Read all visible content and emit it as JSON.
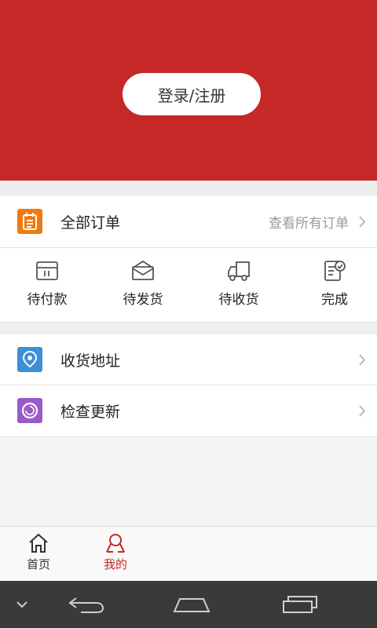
{
  "header": {
    "login_label": "登录/注册",
    "background": "#c62828"
  },
  "orders": {
    "title": "全部订单",
    "view_all": "查看所有订单",
    "icon": "order-list-icon",
    "icon_color": "#f07a12",
    "statuses": [
      {
        "label": "待付款",
        "icon": "wallet-icon"
      },
      {
        "label": "待发货",
        "icon": "package-icon"
      },
      {
        "label": "待收货",
        "icon": "truck-icon"
      },
      {
        "label": "完成",
        "icon": "checklist-icon"
      }
    ]
  },
  "menu": [
    {
      "label": "收货地址",
      "icon": "location-icon",
      "icon_color": "#3d8fd9"
    },
    {
      "label": "检查更新",
      "icon": "update-icon",
      "icon_color": "#9a5ac8"
    }
  ],
  "tabbar": {
    "items": [
      {
        "label": "首页",
        "icon": "home-icon",
        "active": false
      },
      {
        "label": "我的",
        "icon": "user-icon",
        "active": true
      }
    ],
    "active_color": "#c62828",
    "inactive_color": "#333333"
  },
  "system_nav": [
    "chevron-down-icon",
    "back-icon",
    "home-nav-icon",
    "recent-apps-icon"
  ]
}
